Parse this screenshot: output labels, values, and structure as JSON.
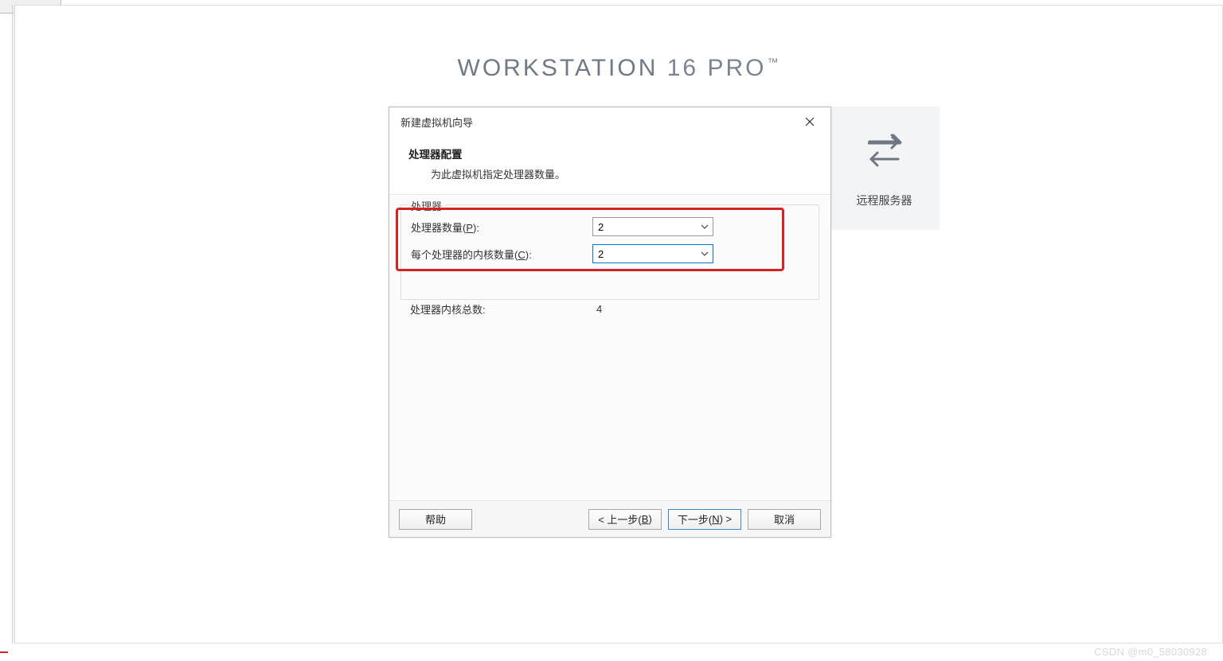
{
  "page": {
    "title_strong": "WORKSTATION",
    "title_ver": "16",
    "title_edition": "PRO",
    "title_tm": "™"
  },
  "tile": {
    "label": "远程服务器"
  },
  "dialog": {
    "window_title": "新建虚拟机向导",
    "heading": "处理器配置",
    "subheading": "为此虚拟机指定处理器数量。",
    "group_caption": "处理器",
    "rows": {
      "processors": {
        "label": "处理器数量(",
        "mnemonic": "P",
        "label_suffix": "):",
        "value": "2"
      },
      "cores": {
        "label": "每个处理器的内核数量(",
        "mnemonic": "C",
        "label_suffix": "):",
        "value": "2"
      },
      "total": {
        "label": "处理器内核总数:",
        "value": "4"
      }
    },
    "buttons": {
      "help": "帮助",
      "back_pre": "< 上一步(",
      "back_m": "B",
      "back_suf": ")",
      "next_pre": "下一步(",
      "next_m": "N",
      "next_suf": ") >",
      "cancel": "取消"
    }
  },
  "watermark": "CSDN @m0_58030928"
}
